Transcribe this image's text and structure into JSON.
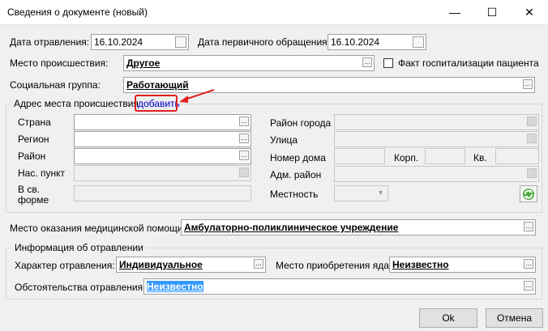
{
  "window": {
    "title": "Сведения о документе (новый)",
    "minimize_glyph": "—",
    "maximize_glyph": "☐",
    "close_glyph": "✕"
  },
  "poisoning_date": {
    "label": "Дата отравления:",
    "value": "16.10.2024"
  },
  "first_visit_date": {
    "label": "Дата первичного обращения:",
    "value": "16.10.2024"
  },
  "incident_place": {
    "label": "Место происшествия:",
    "value": "Другое"
  },
  "hospitalization": {
    "label": "Факт госпитализации пациента",
    "checked": false
  },
  "social_group": {
    "label": "Социальная группа:",
    "value": "Работающий"
  },
  "address": {
    "group_title": "Адрес места происшествия",
    "add_link": "добавить",
    "country_label": "Страна",
    "region_label": "Регион",
    "district_label": "Район",
    "settlement_label": "Нас. пункт",
    "in_form_label": "В св. форме",
    "city_district_label": "Район города",
    "street_label": "Улица",
    "house_label": "Номер дома",
    "building_label": "Корп.",
    "apartment_label": "Кв.",
    "admin_district_label": "Адм. район",
    "locality_label": "Местность"
  },
  "care_place": {
    "label": "Место оказания медицинской помощи:",
    "value": "Амбулаторно-поликлиническое учреждение"
  },
  "poisoning_info": {
    "group_title": "Информация об отравлении",
    "nature_label": "Характер отравления:",
    "nature_value": "Индивидуальное",
    "poison_source_label": "Место приобретения яда:",
    "poison_source_value": "Неизвестно",
    "circumstances_label": "Обстоятельства отравления:",
    "circumstances_value": "Неизвестно"
  },
  "buttons": {
    "ok": "Ok",
    "cancel": "Отмена"
  },
  "colors": {
    "annotation_red": "#e02020",
    "link_blue": "#0000cc",
    "selection_blue": "#3399ff"
  }
}
